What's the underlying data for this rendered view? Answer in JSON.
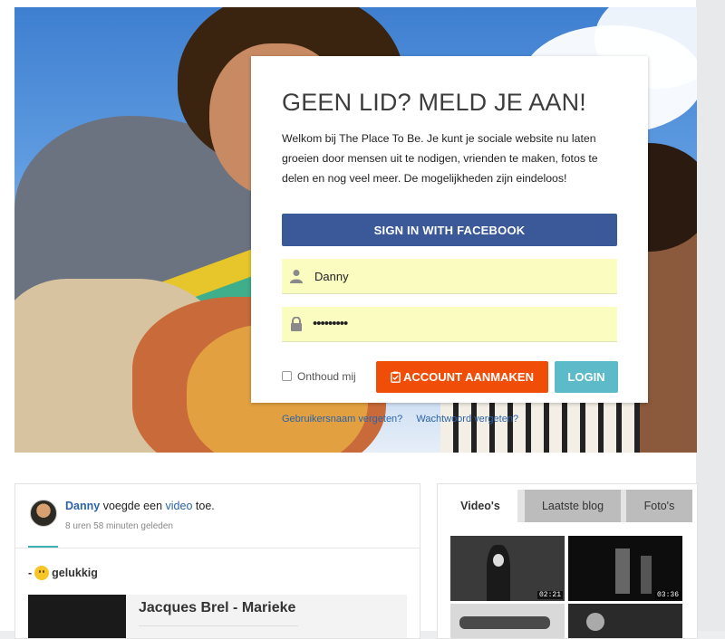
{
  "signup": {
    "title": "GEEN LID? MELD JE AAN!",
    "intro": "Welkom bij The Place To Be. Je kunt je sociale website nu laten groeien door mensen uit te nodigen, vrienden te maken, fotos te delen en nog veel meer. De mogelijkheden zijn eindeloos!",
    "facebook_button": "SIGN IN WITH FACEBOOK",
    "username_value": "Danny",
    "password_value": "•••••••••",
    "remember_label": "Onthoud mij",
    "create_account_button": "ACCOUNT AANMAKEN",
    "login_button": "LOGIN",
    "forgot_username_link": "Gebruikersnaam vergeten?",
    "forgot_password_link": "Wachtwoord vergeten?"
  },
  "activity": {
    "user": "Danny",
    "action_before": "voegde een",
    "action_link": "video",
    "action_after": "toe.",
    "time": "8 uren 58 minuten geleden",
    "mood_prefix": "-",
    "mood_label": "gelukkig",
    "video_title": "Jacques Brel - Marieke"
  },
  "media": {
    "tabs": [
      "Video's",
      "Laatste blog",
      "Foto's"
    ],
    "active_tab": "Video's",
    "videos": [
      {
        "duration": "02:21"
      },
      {
        "duration": "03:36"
      },
      {
        "duration": ""
      },
      {
        "duration": ""
      }
    ]
  },
  "colors": {
    "facebook": "#3b5998",
    "create_account": "#f04e08",
    "login": "#5dbbc9",
    "input_bg": "#fafcc0",
    "link": "#2b63a8"
  }
}
